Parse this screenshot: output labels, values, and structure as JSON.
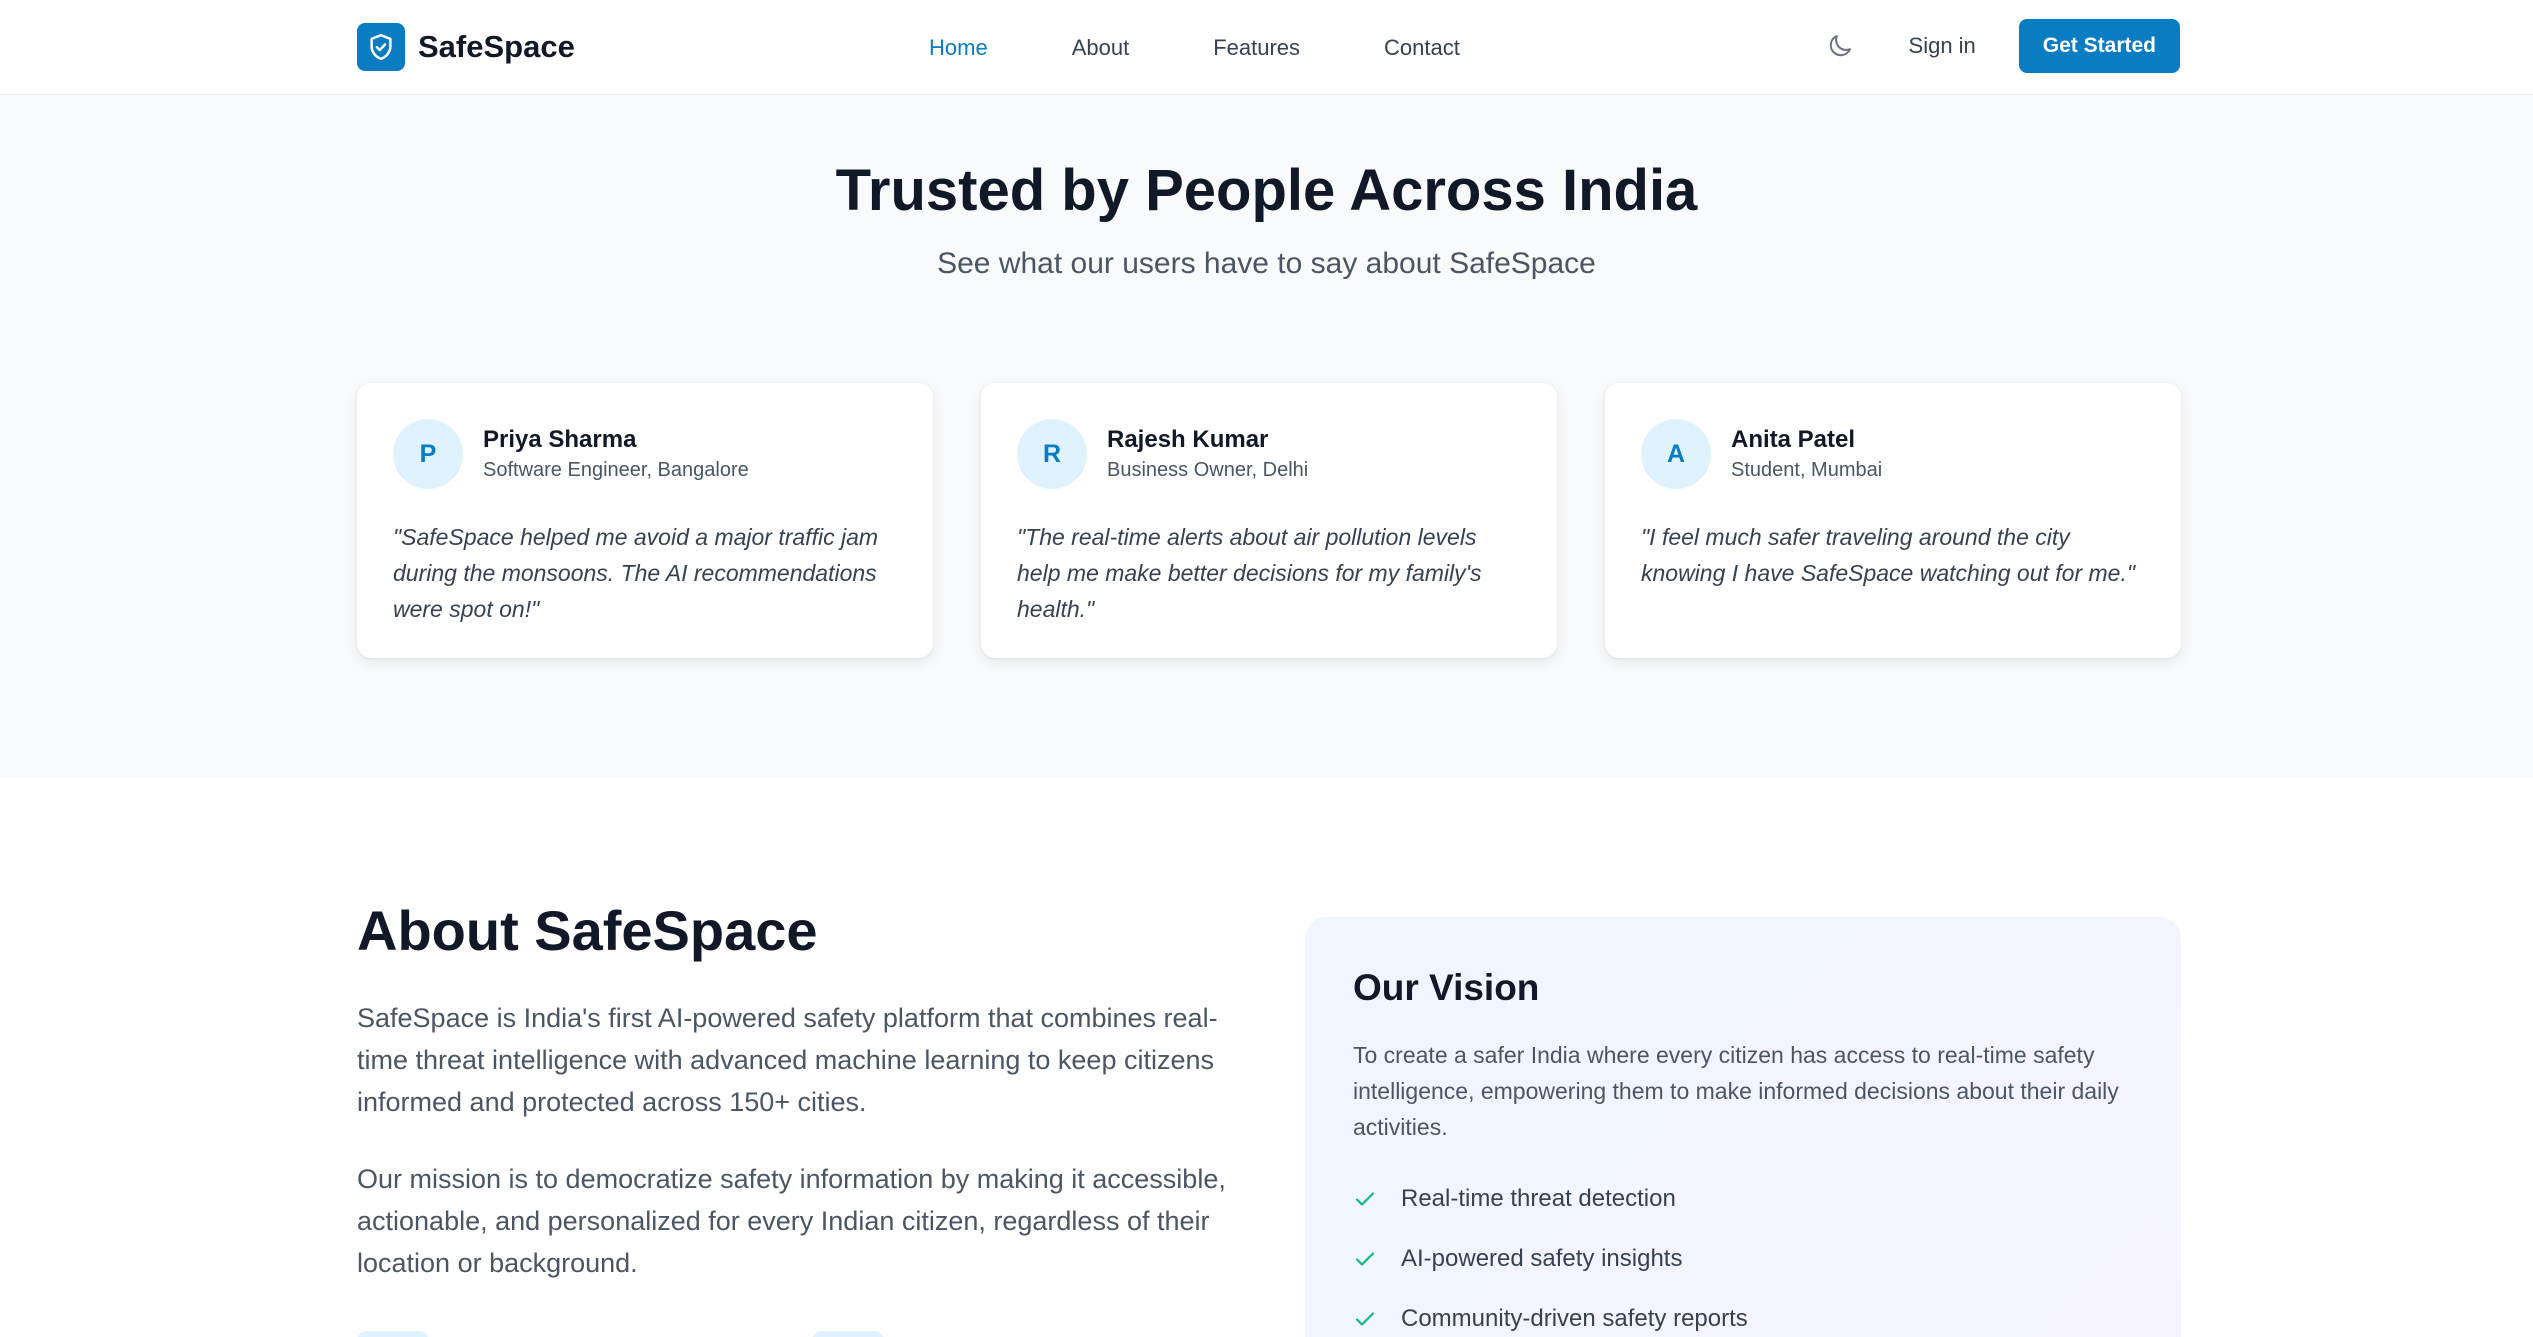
{
  "nav": {
    "brand": "SafeSpace",
    "links": [
      {
        "label": "Home",
        "active": true
      },
      {
        "label": "About",
        "active": false
      },
      {
        "label": "Features",
        "active": false
      },
      {
        "label": "Contact",
        "active": false
      }
    ],
    "theme_icon": "moon-icon",
    "signin": "Sign in",
    "cta": "Get Started"
  },
  "testimonials": {
    "title": "Trusted by People Across India",
    "subtitle": "See what our users have to say about SafeSpace",
    "items": [
      {
        "initial": "P",
        "name": "Priya Sharma",
        "role": "Software Engineer, Bangalore",
        "quote": "\"SafeSpace helped me avoid a major traffic jam during the monsoons. The AI recommendations were spot on!\""
      },
      {
        "initial": "R",
        "name": "Rajesh Kumar",
        "role": "Business Owner, Delhi",
        "quote": "\"The real-time alerts about air pollution levels help me make better decisions for my family's health.\""
      },
      {
        "initial": "A",
        "name": "Anita Patel",
        "role": "Student, Mumbai",
        "quote": "\"I feel much safer traveling around the city knowing I have SafeSpace watching out for me.\""
      }
    ]
  },
  "about": {
    "title": "About SafeSpace",
    "paragraphs": [
      "SafeSpace is India's first AI-powered safety platform that combines real-time threat intelligence with advanced machine learning to keep citizens informed and protected across 150+ cities.",
      "Our mission is to democratize safety information by making it accessible, actionable, and personalized for every Indian citizen, regardless of their location or background."
    ],
    "vision": {
      "title": "Our Vision",
      "text": "To create a safer India where every citizen has access to real-time safety intelligence, empowering them to make informed decisions about their daily activities.",
      "points": [
        "Real-time threat detection",
        "AI-powered safety insights",
        "Community-driven safety reports"
      ]
    }
  },
  "colors": {
    "brand": "#0a7cc1",
    "check": "#10b981",
    "section_bg": "#f8fafc"
  }
}
